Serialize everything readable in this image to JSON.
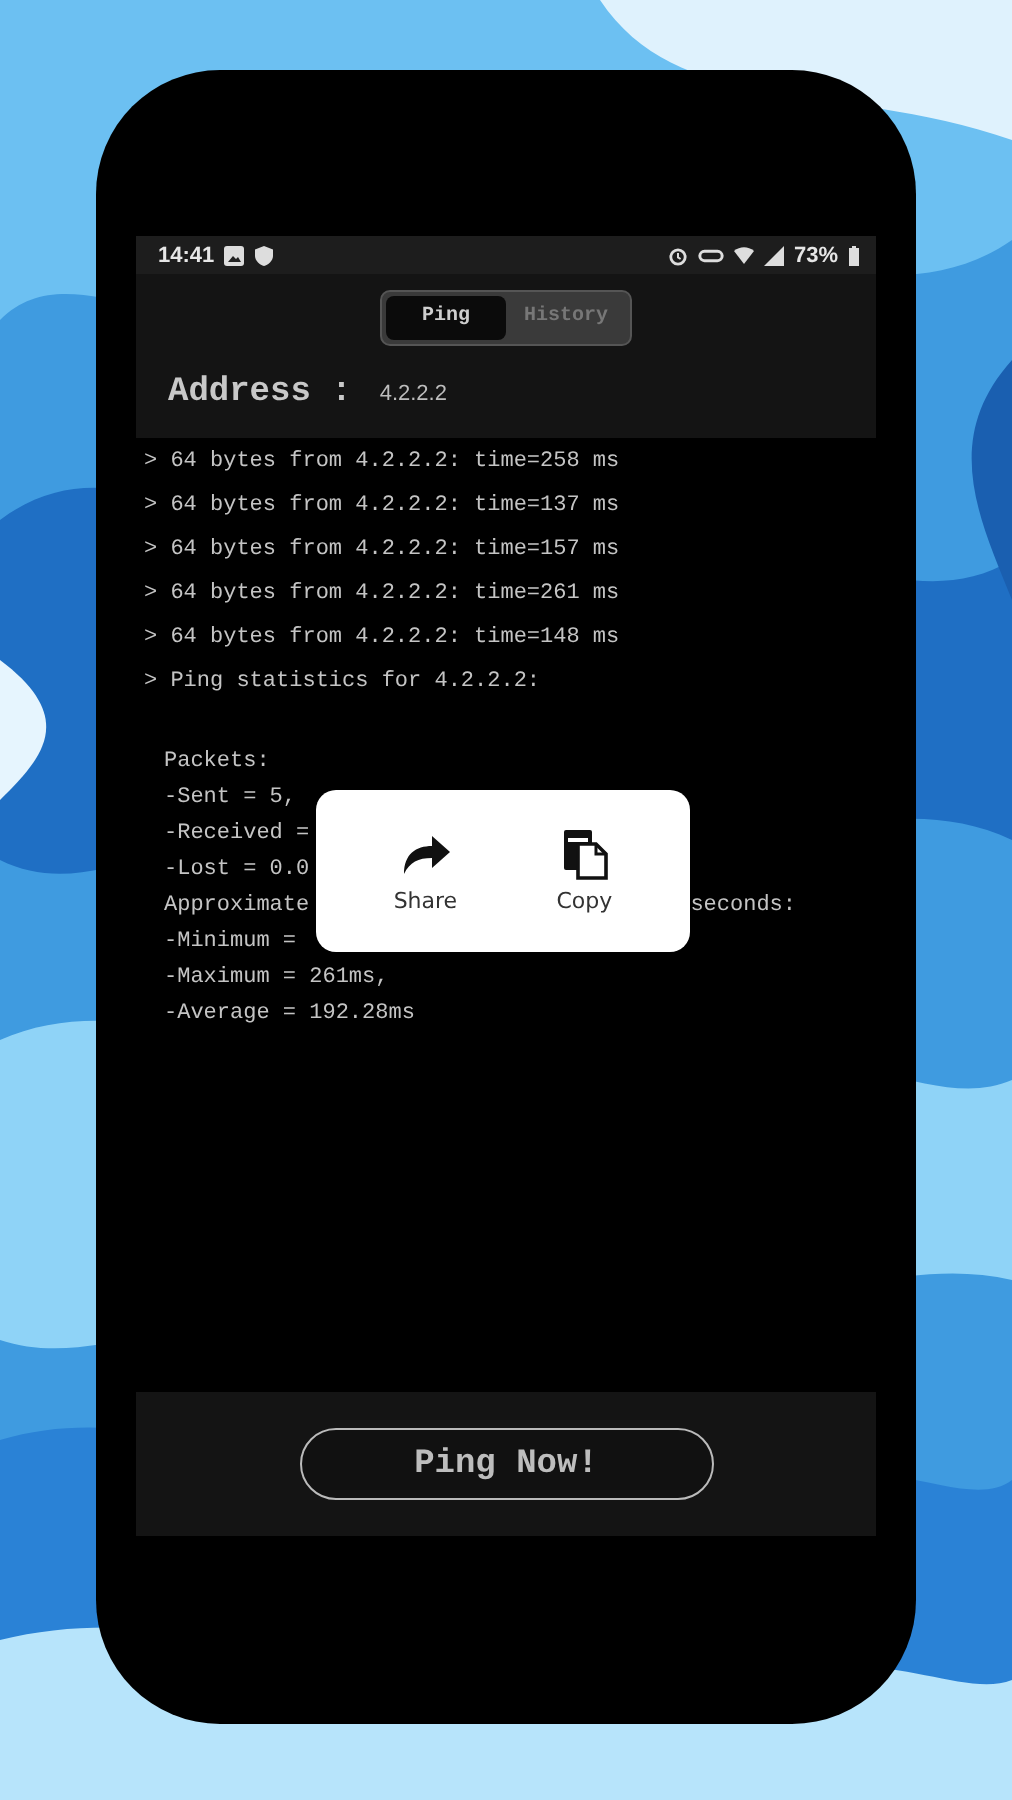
{
  "status_bar": {
    "time": "14:41",
    "battery": "73%"
  },
  "tabs": [
    {
      "label": "Ping",
      "selected": true
    },
    {
      "label": "History",
      "selected": false
    }
  ],
  "address": {
    "label": "Address :",
    "value": "4.2.2.2"
  },
  "replies": [
    "> 64 bytes from 4.2.2.2: time=258 ms",
    "> 64 bytes from 4.2.2.2: time=137 ms",
    "> 64 bytes from 4.2.2.2: time=157 ms",
    "> 64 bytes from 4.2.2.2: time=261 ms",
    "> 64 bytes from 4.2.2.2: time=148 ms",
    "> Ping statistics for 4.2.2.2:"
  ],
  "statistics": [
    {
      "text": "Packets:"
    },
    {
      "text": "-Sent = 5,"
    },
    {
      "text": "-Received ="
    },
    {
      "text": "-Lost = 0.0"
    },
    {
      "text": "Approximate",
      "text_right": "seconds:"
    },
    {
      "text": "-Minimum ="
    },
    {
      "text": "-Maximum = 261ms,"
    },
    {
      "text": "-Average = 192.28ms"
    }
  ],
  "popup": {
    "actions": [
      {
        "kind": "share",
        "label": "Share"
      },
      {
        "kind": "copy",
        "label": "Copy"
      }
    ]
  },
  "ping_button": "Ping Now!"
}
